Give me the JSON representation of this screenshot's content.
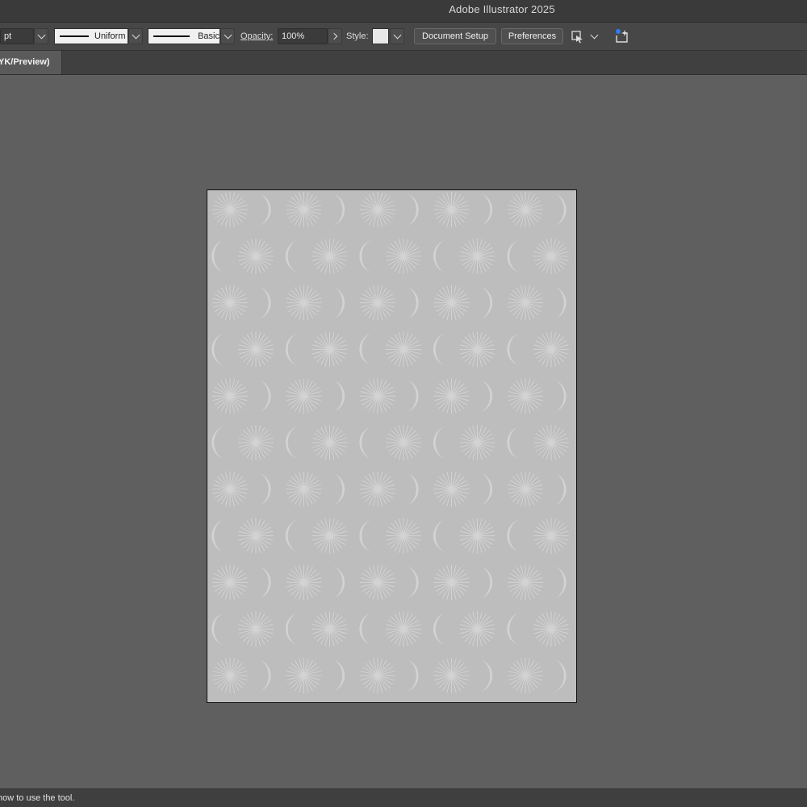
{
  "app": {
    "title": "Adobe Illustrator 2025"
  },
  "controlbar": {
    "stroke_unit": "pt",
    "variable_width_profile": "Uniform",
    "brush_definition": "Basic",
    "opacity_label": "Opacity:",
    "opacity_value": "100%",
    "style_label": "Style:",
    "document_setup_label": "Document Setup",
    "preferences_label": "Preferences",
    "icons": {
      "arrange": "arrange-documents-icon",
      "discover": "discover-sparkle-icon"
    }
  },
  "tabs": [
    {
      "label": "YK/Preview)"
    }
  ],
  "artboard": {
    "pattern": {
      "motifs": [
        "sunburst-icon",
        "crescent-moon-icon"
      ],
      "columns": 5,
      "rows": 11
    },
    "colors": {
      "background": "#bdbdbd",
      "motif": "#d3d3d3"
    }
  },
  "status": {
    "text": "how to use the tool."
  }
}
